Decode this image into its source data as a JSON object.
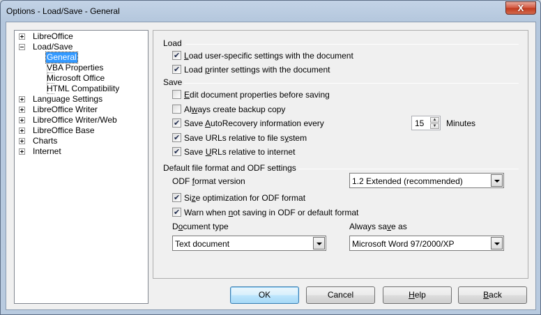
{
  "window": {
    "title": "Options - Load/Save - General",
    "close_glyph": "X"
  },
  "tree": {
    "items": [
      {
        "label": "LibreOffice",
        "expander": "+"
      },
      {
        "label": "Load/Save",
        "expander": "-"
      },
      {
        "label": "General",
        "selected": true
      },
      {
        "label": "VBA Properties"
      },
      {
        "label": "Microsoft Office"
      },
      {
        "label": "HTML Compatibility"
      },
      {
        "label": "Language Settings",
        "expander": "+"
      },
      {
        "label": "LibreOffice Writer",
        "expander": "+"
      },
      {
        "label": "LibreOffice Writer/Web",
        "expander": "+"
      },
      {
        "label": "LibreOffice Base",
        "expander": "+"
      },
      {
        "label": "Charts",
        "expander": "+"
      },
      {
        "label": "Internet",
        "expander": "+"
      }
    ]
  },
  "load": {
    "heading": "Load",
    "user_settings": {
      "pre": "",
      "key": "L",
      "post": "oad user-specific settings with the document",
      "checked": true
    },
    "printer_settings": {
      "pre": "Load ",
      "key": "p",
      "post": "rinter settings with the document",
      "checked": true
    }
  },
  "save": {
    "heading": "Save",
    "edit_props": {
      "pre": "",
      "key": "E",
      "post": "dit document properties before saving",
      "checked": false
    },
    "backup": {
      "pre": "Al",
      "key": "w",
      "post": "ays create backup copy",
      "checked": false
    },
    "autorecovery": {
      "pre": "Save ",
      "key": "A",
      "post": "utoRecovery information every",
      "checked": true
    },
    "autorecovery_value": "15",
    "autorecovery_unit": "Minutes",
    "urls_fs": {
      "pre": "Save URLs relative to file s",
      "key": "y",
      "post": "stem",
      "checked": true
    },
    "urls_inet": {
      "pre": "Save ",
      "key": "U",
      "post": "RLs relative to internet",
      "checked": true
    }
  },
  "odf": {
    "heading": "Default file format and ODF settings",
    "version_label": {
      "pre": "ODF ",
      "key": "f",
      "post": "ormat version"
    },
    "version_value": "1.2 Extended (recommended)",
    "size_opt": {
      "pre": "Si",
      "key": "z",
      "post": "e optimization for ODF format",
      "checked": true
    },
    "warn": {
      "pre": "Warn when ",
      "key": "n",
      "post": "ot saving in ODF or default format",
      "checked": true
    },
    "doc_type_label": {
      "pre": "D",
      "key": "o",
      "post": "cument type"
    },
    "doc_type_value": "Text document",
    "always_save_label": {
      "pre": "Always sa",
      "key": "v",
      "post": "e as"
    },
    "always_save_value": "Microsoft Word 97/2000/XP"
  },
  "buttons": {
    "ok": {
      "pre": "OK",
      "key": "",
      "post": ""
    },
    "cancel": {
      "pre": "Cancel",
      "key": "",
      "post": ""
    },
    "help": {
      "pre": "",
      "key": "H",
      "post": "elp"
    },
    "back": {
      "pre": "",
      "key": "B",
      "post": "ack"
    }
  }
}
